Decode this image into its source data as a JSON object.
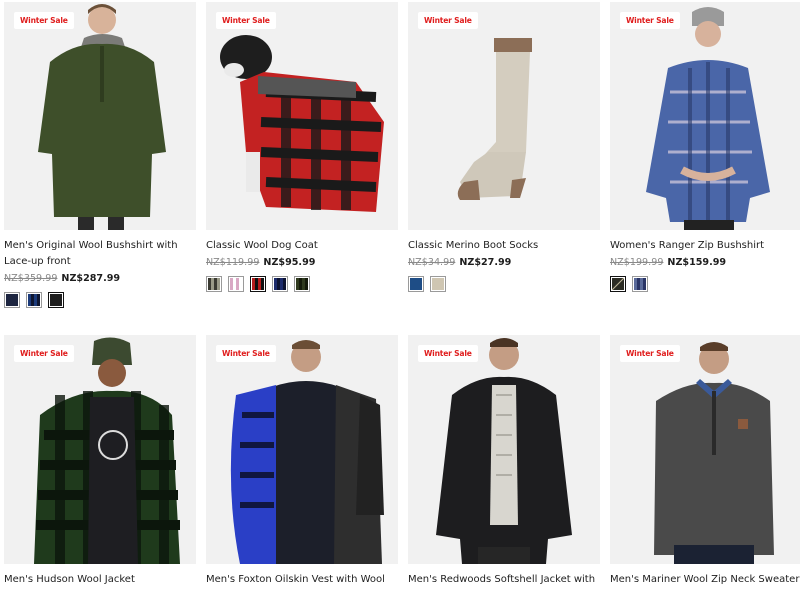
{
  "products": [
    {
      "badge": "Winter Sale",
      "title": "Men's Original Wool Bushshirt with Lace-up front",
      "was_price": "NZ$359.99",
      "now_price": "NZ$287.99",
      "swatches": [
        {
          "color": "#1d2540",
          "name": "navy"
        },
        {
          "color": "#1b3a7a",
          "name": "blue-check"
        },
        {
          "color": "#1f1f1f",
          "name": "black"
        }
      ]
    },
    {
      "badge": "Winter Sale",
      "title": "Classic Wool Dog Coat",
      "was_price": "NZ$119.99",
      "now_price": "NZ$95.99",
      "swatches": [
        {
          "color": "#3a3a32",
          "name": "grey-check"
        },
        {
          "color": "#d9a8c4",
          "name": "pink-check"
        },
        {
          "color": "#b51c1c",
          "name": "red-black-check"
        },
        {
          "color": "#1b2a6b",
          "name": "blue-check"
        },
        {
          "color": "#2f3a1e",
          "name": "olive-check"
        }
      ]
    },
    {
      "badge": "Winter Sale",
      "title": "Classic Merino Boot Socks",
      "was_price": "NZ$34.99",
      "now_price": "NZ$27.99",
      "swatches": [
        {
          "color": "#1e4d86",
          "name": "blue"
        },
        {
          "color": "#cfc6b2",
          "name": "oatmeal"
        }
      ]
    },
    {
      "badge": "Winter Sale",
      "title": "Women's Ranger Zip Bushshirt",
      "was_price": "NZ$199.99",
      "now_price": "NZ$159.99",
      "swatches": [
        {
          "color": "#2c2c24",
          "name": "olive-check"
        },
        {
          "color": "#5a6a9a",
          "name": "blue-check"
        }
      ]
    },
    {
      "badge": "Winter Sale",
      "title": "Men's Hudson Wool Jacket",
      "was_price": "",
      "now_price": "",
      "swatches": []
    },
    {
      "badge": "Winter Sale",
      "title": "Men's Foxton Oilskin Vest with Wool",
      "was_price": "",
      "now_price": "",
      "swatches": []
    },
    {
      "badge": "Winter Sale",
      "title": "Men's Redwoods Softshell Jacket with",
      "was_price": "",
      "now_price": "",
      "swatches": []
    },
    {
      "badge": "Winter Sale",
      "title": "Men's Mariner Wool Zip Neck Sweater",
      "was_price": "",
      "now_price": "",
      "swatches": []
    }
  ],
  "colors": {
    "sale_badge_text": "#e01e1e",
    "image_bg": "#f1f1f1",
    "was_price": "#8a8a8a"
  }
}
